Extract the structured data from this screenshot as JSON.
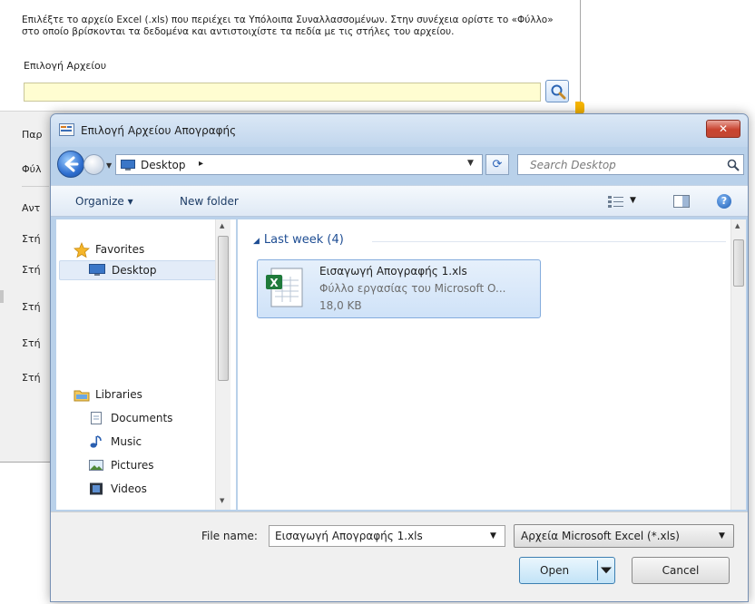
{
  "background_window": {
    "instructions": "Επιλέξτε το αρχείο Excel (.xls) που περιέχει τα Υπόλοιπα Συναλλασσομένων. Στην συνέχεια ορίστε το «Φύλλο» στο οποίο βρίσκονται τα δεδομένα και αντιστοιχίστε τα πεδία με τις στήλες του αρχείου.",
    "file_select_label": "Επιλογή Αρχείου",
    "file_path_value": "",
    "partial_labels": [
      "Παρ",
      "Φύλ",
      "Αντ",
      "Στή",
      "Στή",
      "Στή",
      "Στή",
      "Στή"
    ]
  },
  "dialog": {
    "title": "Επιλογή Αρχείου Απογραφής",
    "close_label": "✕",
    "address": {
      "location": "Desktop",
      "separator": "▸"
    },
    "search": {
      "placeholder": "Search Desktop"
    },
    "toolbar": {
      "organize": "Organize ▾",
      "new_folder": "New folder",
      "help": "?"
    },
    "nav": {
      "favorites": "Favorites",
      "desktop": "Desktop",
      "libraries": "Libraries",
      "documents": "Documents",
      "music": "Music",
      "pictures": "Pictures",
      "videos": "Videos"
    },
    "file_group": {
      "header": "Last week (4)"
    },
    "files": [
      {
        "name": "Εισαγωγή Απογραφής 1.xls",
        "type": "Φύλλο εργασίας του Microsoft O...",
        "size": "18,0 KB"
      }
    ],
    "file_name_label": "File name:",
    "file_name_value": "Εισαγωγή Απογραφής 1.xls",
    "file_type": "Αρχεία Microsoft Excel (*.xls)",
    "open_label": "Open",
    "cancel_label": "Cancel"
  },
  "colors": {
    "dialog_frame": "#b9d1ea",
    "close_button": "#c9432f",
    "selection": "#cfe2f8",
    "group_header": "#1e4d93",
    "input_highlight": "#fffdd1"
  }
}
